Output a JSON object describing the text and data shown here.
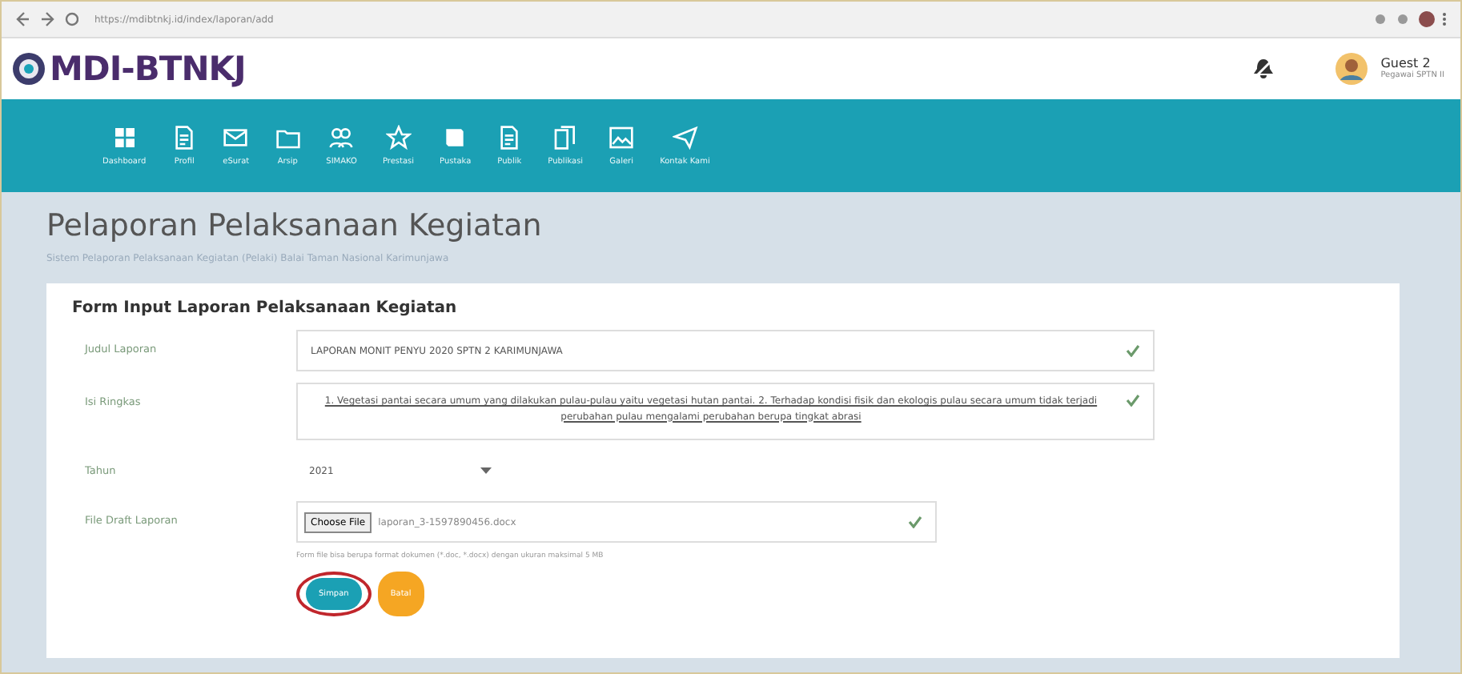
{
  "browser": {
    "url": "https://mdibtnkj.id/index/laporan/add"
  },
  "header": {
    "logo": "MDI-BTNKJ",
    "user_name": "Guest 2",
    "user_role": "Pegawai SPTN II"
  },
  "nav": [
    {
      "label": "Dashboard"
    },
    {
      "label": "Profil"
    },
    {
      "label": "eSurat"
    },
    {
      "label": "Arsip"
    },
    {
      "label": "SIMAKO"
    },
    {
      "label": "Prestasi"
    },
    {
      "label": "Pustaka"
    },
    {
      "label": "Publik"
    },
    {
      "label": "Publikasi"
    },
    {
      "label": "Galeri"
    },
    {
      "label": "Kontak Kami"
    }
  ],
  "page": {
    "title": "Pelaporan Pelaksanaan Kegiatan",
    "subtitle": "Sistem Pelaporan Pelaksanaan Kegiatan (Pelaki) Balai Taman Nasional Karimunjawa"
  },
  "form": {
    "title": "Form Input Laporan Pelaksanaan Kegiatan",
    "fields": [
      {
        "kind": "text",
        "label": "Judul Laporan",
        "value": "LAPORAN MONIT PENYU 2020 SPTN 2 KARIMUNJAWA"
      },
      {
        "kind": "textarea",
        "label": "Isi Ringkas",
        "value": "1. Vegetasi pantai secara umum yang dilakukan pulau-pulau yaitu vegetasi hutan pantai. 2. Terhadap kondisi fisik dan ekologis pulau secara umum tidak terjadi perubahan pulau mengalami perubahan berupa tingkat abrasi"
      },
      {
        "kind": "select",
        "label": "Tahun",
        "value": "2021"
      },
      {
        "kind": "file",
        "label": "File Draft Laporan",
        "button": "Choose File",
        "value": "laporan_3-1597890456.docx",
        "hint": "Form file bisa berupa format dokumen (*.doc, *.docx) dengan ukuran maksimal 5 MB"
      }
    ],
    "buttons": [
      {
        "label": "Simpan",
        "kind": "primary"
      },
      {
        "label": "Batal",
        "kind": "warning"
      }
    ]
  }
}
